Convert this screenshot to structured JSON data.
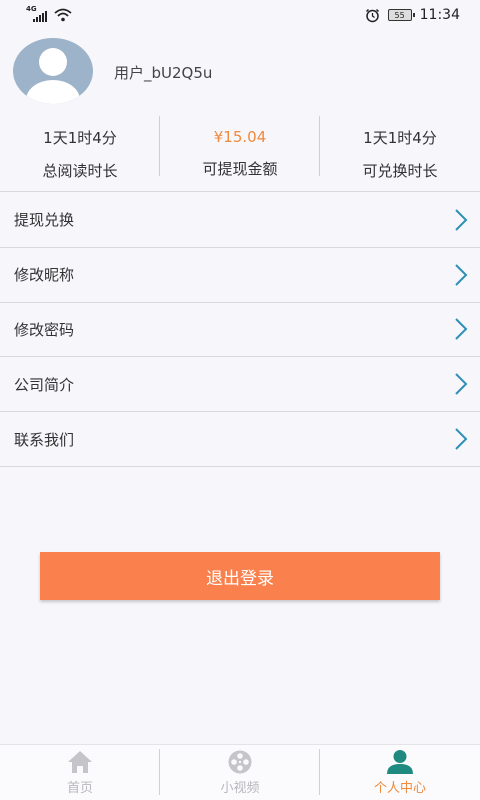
{
  "status_bar": {
    "network_label": "4G",
    "battery": "55",
    "time": "11:34",
    "icons": [
      "signal-icon",
      "wifi-icon",
      "alarm-icon",
      "battery-icon"
    ]
  },
  "profile": {
    "username": "用户_bU2Q5u",
    "avatar_icon": "user-avatar-icon"
  },
  "stats": [
    {
      "value": "1天1时4分",
      "label": "总阅读时长"
    },
    {
      "value": "¥15.04",
      "label": "可提现金额"
    },
    {
      "value": "1天1时4分",
      "label": "可兑换时长"
    }
  ],
  "menu": [
    {
      "label": "提现兑换",
      "icon": "chevron-right-icon"
    },
    {
      "label": "修改昵称",
      "icon": "chevron-right-icon"
    },
    {
      "label": "修改密码",
      "icon": "chevron-right-icon"
    },
    {
      "label": "公司简介",
      "icon": "chevron-right-icon"
    },
    {
      "label": "联系我们",
      "icon": "chevron-right-icon"
    }
  ],
  "logout_label": "退出登录",
  "bottom_nav": [
    {
      "label": "首页",
      "icon": "home-icon",
      "active": false
    },
    {
      "label": "小视频",
      "icon": "film-reel-icon",
      "active": false
    },
    {
      "label": "个人中心",
      "icon": "person-icon",
      "active": true
    }
  ],
  "colors": {
    "accent": "#fa814d",
    "money": "#f08a3c",
    "chevron": "#2f8fb5",
    "active_icon": "#1f8a80",
    "inactive_icon": "#c4c4c9"
  }
}
